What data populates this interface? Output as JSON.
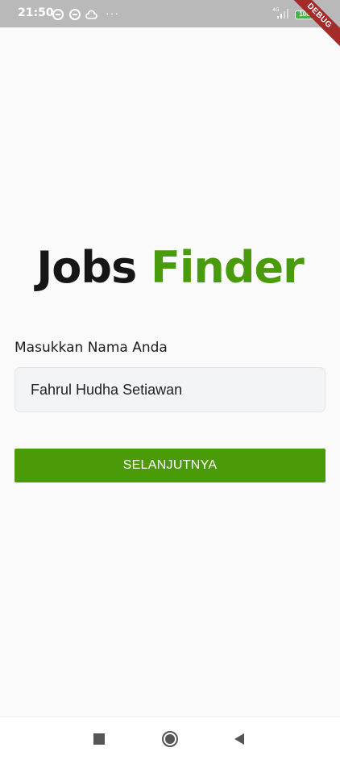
{
  "status_bar": {
    "time": "21:50",
    "network": "4G",
    "battery": "100",
    "debug_label": "DEBUG",
    "icons": [
      "sync-icon",
      "sync-icon",
      "cloud-icon",
      "more-dots-icon",
      "signal-icon",
      "battery-icon"
    ]
  },
  "title": {
    "part1": "Jobs",
    "part2": "Finder"
  },
  "form": {
    "label": "Masukkan Nama Anda",
    "name_value": "Fahrul Hudha Setiawan",
    "next_button": "SELANJUTNYA"
  },
  "nav": {
    "icons": [
      "recents-square-icon",
      "home-circle-icon",
      "back-triangle-icon"
    ]
  },
  "colors": {
    "accent": "#4b9a07",
    "title_green": "#4a9b0c",
    "title_dark": "#161616",
    "status_bar": "#b9b9b9",
    "background": "#fafafa"
  }
}
